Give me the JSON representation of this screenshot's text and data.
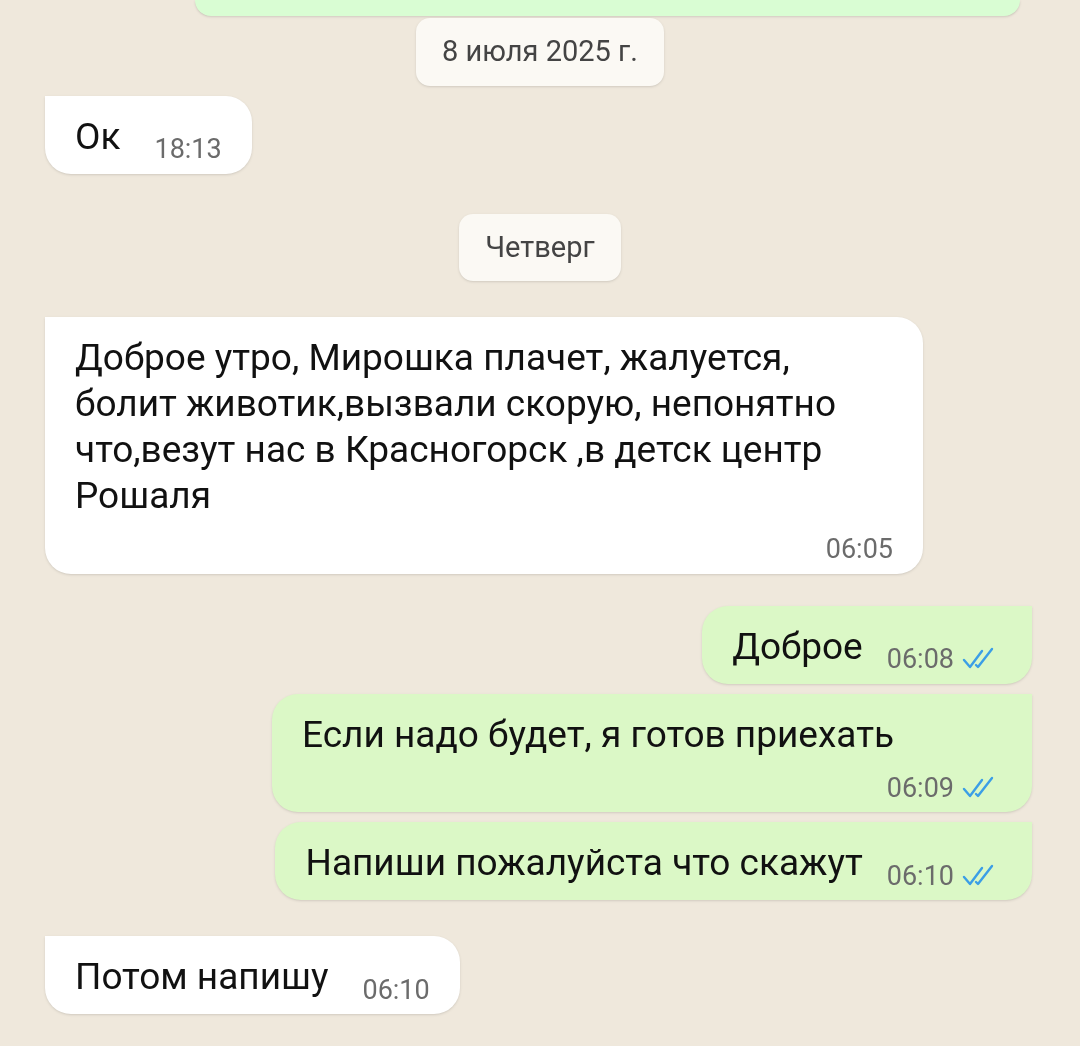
{
  "messages": [
    {
      "kind": "partial"
    },
    {
      "kind": "date",
      "text": "8 июля 2025 г."
    },
    {
      "kind": "incoming",
      "text": "Ок",
      "time": "18:13"
    },
    {
      "kind": "date",
      "text": "Четверг"
    },
    {
      "kind": "incoming",
      "text": "Доброе утро, Мирошка плачет, жалуется, болит животик,вызвали скорую, непонятно что,везут нас в Красногорск ,в детск центр  Рошаля",
      "time": "06:05"
    },
    {
      "kind": "outgoing",
      "text": "Доброе",
      "time": "06:08",
      "read": true
    },
    {
      "kind": "outgoing",
      "text": "Если надо будет, я готов приехать",
      "time": "06:09",
      "read": true
    },
    {
      "kind": "outgoing",
      "text": "Напиши пожалуйста что скажут",
      "time": "06:10",
      "read": true
    },
    {
      "kind": "incoming",
      "text": "Потом напишу",
      "time": "06:10"
    }
  ]
}
